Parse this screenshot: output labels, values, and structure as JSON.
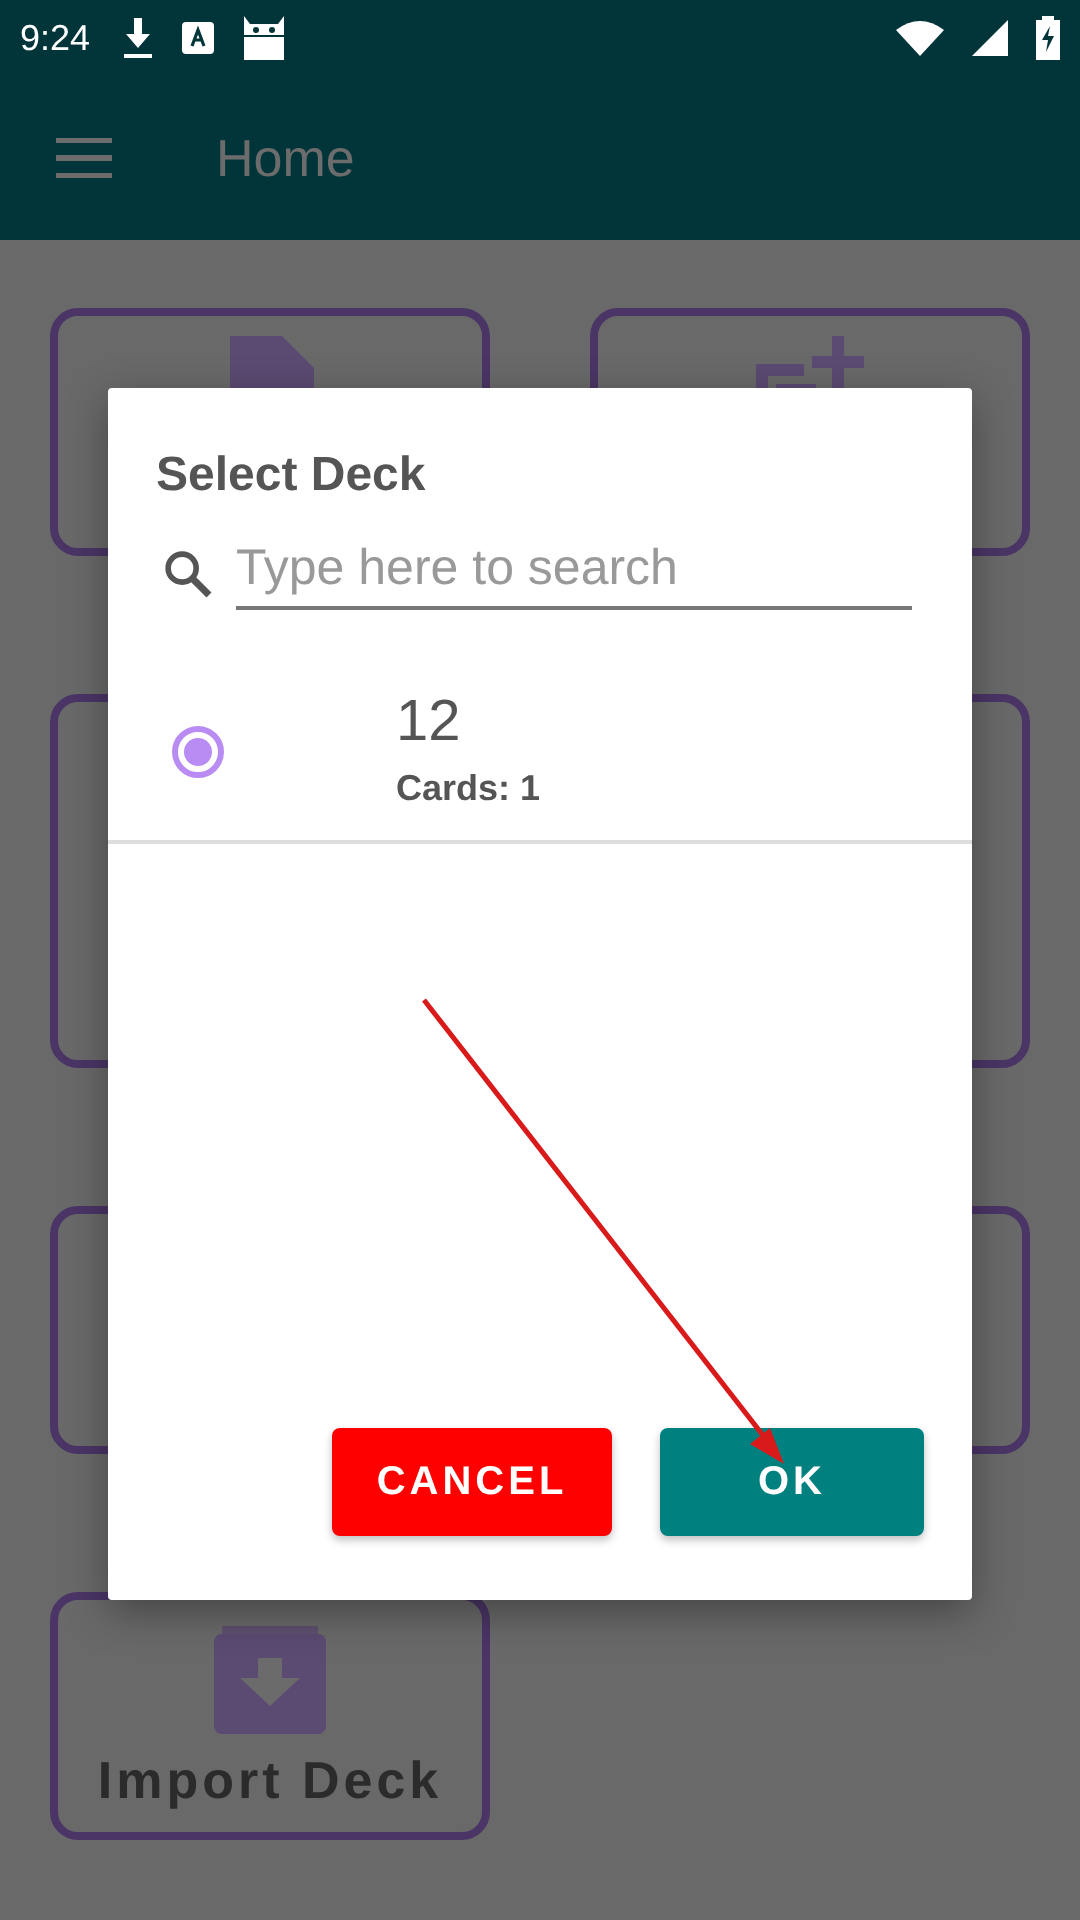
{
  "status_bar": {
    "time": "9:24"
  },
  "app_bar": {
    "title": "Home"
  },
  "home_cards": [
    {
      "kind": "file"
    },
    {
      "kind": "add"
    },
    {
      "kind": "plain"
    },
    {
      "kind": "plain"
    },
    {
      "kind": "plain"
    },
    {
      "kind": "plain"
    },
    {
      "kind": "import",
      "label": "Import Deck"
    }
  ],
  "dialog": {
    "title": "Select Deck",
    "search": {
      "placeholder": "Type here to search"
    },
    "decks": [
      {
        "name": "12",
        "count": "Cards: 1",
        "selected": true
      }
    ],
    "buttons": [
      {
        "label": "CANCEL",
        "kind": "cancel"
      },
      {
        "label": "OK",
        "kind": "ok"
      }
    ]
  }
}
